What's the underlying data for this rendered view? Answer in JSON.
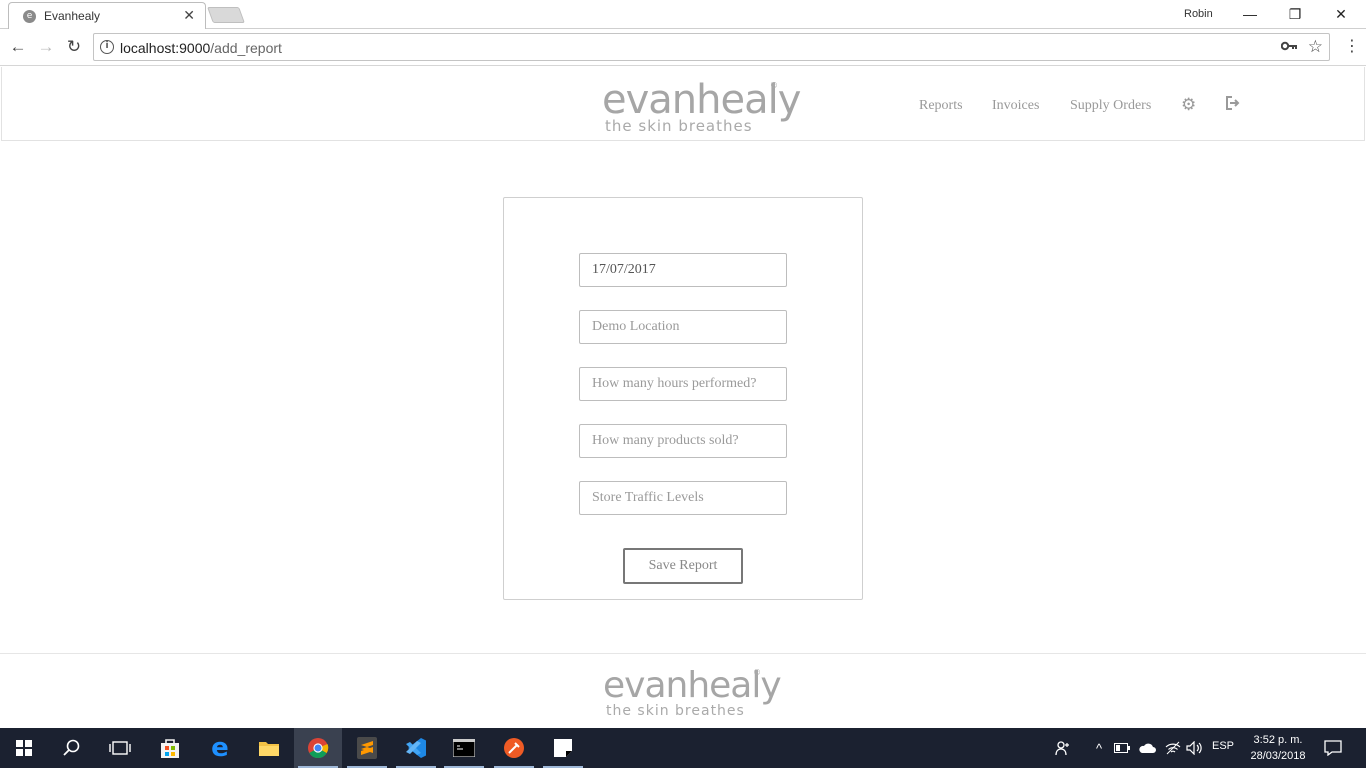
{
  "browser": {
    "tab_title": "Evanhealy",
    "favicon_letter": "e",
    "profile_name": "Robin",
    "url_host": "localhost:9000",
    "url_path": "/add_report"
  },
  "header": {
    "logo_brand": "evanhealy",
    "logo_tagline": "the skin breathes",
    "logo_reg": "®",
    "nav": {
      "reports": "Reports",
      "invoices": "Invoices",
      "supply_orders": "Supply Orders"
    }
  },
  "form": {
    "date_value": "17/07/2017",
    "location_placeholder": "Demo Location",
    "hours_placeholder": "How many hours performed?",
    "products_placeholder": "How many products sold?",
    "traffic_placeholder": "Store Traffic Levels",
    "save_label": "Save Report"
  },
  "footer": {
    "logo_brand": "evanhealy",
    "logo_tagline": "the skin breathes",
    "logo_reg": "®"
  },
  "taskbar": {
    "language": "ESP",
    "time": "3:52 p. m.",
    "date": "28/03/2018"
  }
}
